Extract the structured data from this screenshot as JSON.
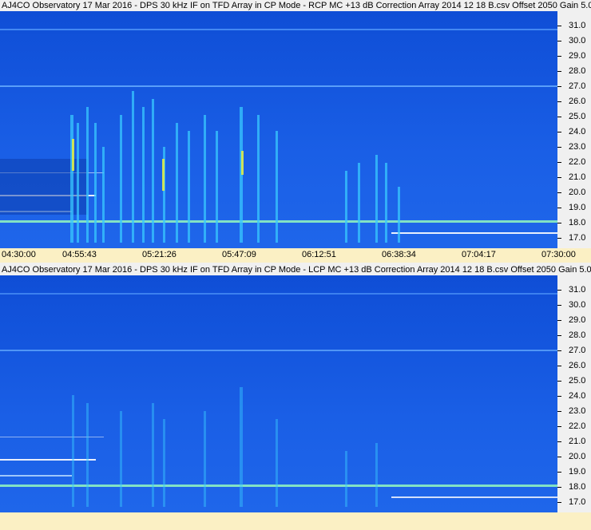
{
  "panels": [
    {
      "title": "AJ4CO Observatory 17 Mar 2016 - DPS 30 kHz IF on TFD Array in CP Mode - RCP  MC +13 dB  Correction Array 2014 12 18 B.csv  Offset 2050  Gain 5.0",
      "x_ticks": [
        "04:30:00",
        "04:55:43",
        "05:21:26",
        "05:47:09",
        "06:12:51",
        "06:38:34",
        "07:04:17",
        "07:30:00"
      ],
      "y_ticks": [
        "31.0",
        "30.0",
        "29.0",
        "28.0",
        "27.0",
        "26.0",
        "25.0",
        "24.0",
        "23.0",
        "22.0",
        "21.0",
        "20.0",
        "19.0",
        "18.0",
        "17.0"
      ]
    },
    {
      "title": "AJ4CO Observatory 17 Mar 2016 - DPS 30 kHz IF on TFD Array in CP Mode - LCP  MC +13 dB  Correction Array 2014 12 18 B.csv  Offset 2050  Gain 5.0",
      "x_ticks": [],
      "y_ticks": [
        "31.0",
        "30.0",
        "29.0",
        "28.0",
        "27.0",
        "26.0",
        "25.0",
        "24.0",
        "23.0",
        "22.0",
        "21.0",
        "20.0",
        "19.0",
        "18.0",
        "17.0"
      ]
    }
  ],
  "colors": {
    "background_blue": "#1456de",
    "burst_cyan": "#38c8ff",
    "burst_yellow": "#e8f040",
    "axis_bg": "#fbf0c4"
  }
}
